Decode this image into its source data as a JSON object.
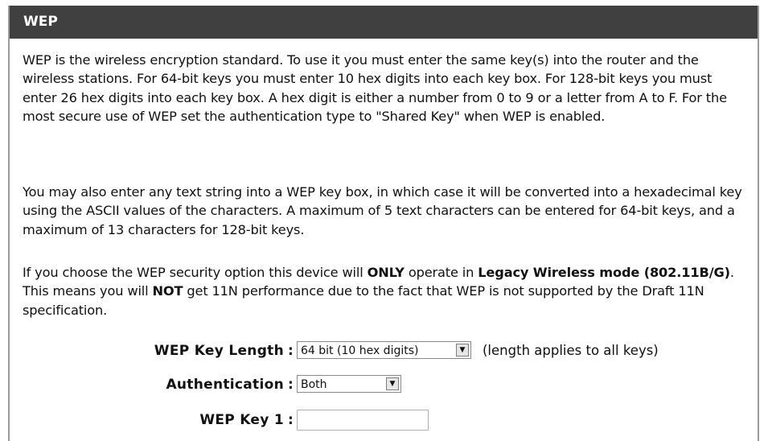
{
  "section": {
    "title": "WEP",
    "para1": "WEP is the wireless encryption standard. To use it you must enter the same key(s) into the router and the wireless stations. For 64-bit keys you must enter 10 hex digits into each key box. For 128-bit keys you must enter 26 hex digits into each key box. A hex digit is either a number from 0 to 9 or a letter from A to F. For the most secure use of WEP set the authentication type to \"Shared Key\" when WEP is enabled.",
    "para2": "You may also enter any text string into a WEP key box, in which case it will be converted into a hexadecimal key using the ASCII values of the characters. A maximum of 5 text characters can be entered for 64-bit keys, and a maximum of 13 characters for 128-bit keys.",
    "para3": {
      "t1": "If you choose the WEP security option this device will ",
      "b1": "ONLY",
      "t2": " operate in ",
      "b2": "Legacy Wireless mode (802.11B/G)",
      "t3": ". This means you will ",
      "b3": "NOT",
      "t4": " get 11N performance due to the fact that WEP is not supported by the Draft 11N specification."
    }
  },
  "form": {
    "colon": ":",
    "key_length": {
      "label": "WEP Key Length",
      "value": "64 bit (10 hex digits)",
      "note": "(length applies to all keys)"
    },
    "authentication": {
      "label": "Authentication",
      "value": "Both"
    },
    "wep_key_1": {
      "label": "WEP Key 1",
      "value": ""
    }
  },
  "icons": {
    "dropdown": "chevron-down-icon",
    "dropdown_glyph": "▼"
  }
}
